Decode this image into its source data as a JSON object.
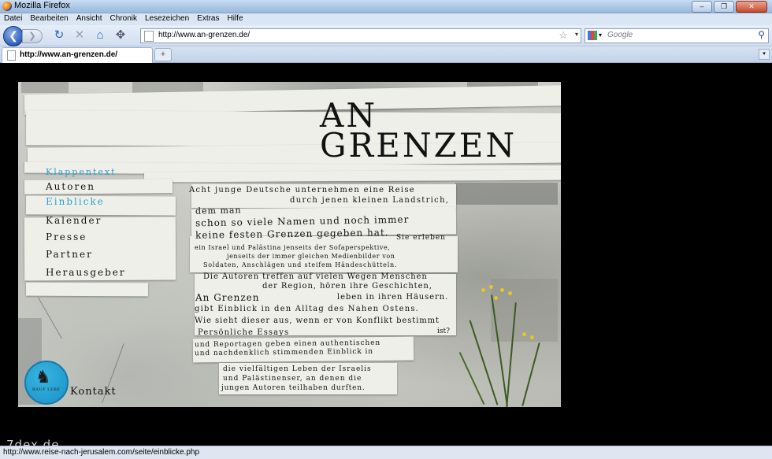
{
  "window": {
    "title": "Mozilla Firefox",
    "min_glyph": "–",
    "max_glyph": "❐",
    "close_glyph": "✕"
  },
  "menu": [
    "Datei",
    "Bearbeiten",
    "Ansicht",
    "Chronik",
    "Lesezeichen",
    "Extras",
    "Hilfe"
  ],
  "toolbar": {
    "back_glyph": "❮",
    "forward_glyph": "❯",
    "reload_glyph": "↻",
    "stop_glyph": "✕",
    "home_glyph": "⌂",
    "addon_glyph": "✥",
    "address": "http://www.an-grenzen.de/",
    "bookmark_glyph": "☆",
    "dropdown_glyph": "▾",
    "search_placeholder": "Google",
    "search_glyph": "⚲"
  },
  "tabs": [
    {
      "title": "http://www.an-grenzen.de/"
    }
  ],
  "tabbar": {
    "new_tab_glyph": "+",
    "list_glyph": "▾"
  },
  "site": {
    "logo_line1": "AN",
    "logo_line2": "GRENZEN",
    "nav": [
      {
        "label": "Klappentext",
        "active": true
      },
      {
        "label": "Autoren",
        "active": false
      },
      {
        "label": "Einblicke",
        "active": true
      },
      {
        "label": "Kalender",
        "active": false
      },
      {
        "label": "Presse",
        "active": false
      },
      {
        "label": "Partner",
        "active": false
      },
      {
        "label": "Herausgeber",
        "active": false
      }
    ],
    "blurb": [
      "Acht junge Deutsche unternehmen eine Reise",
      "durch jenen kleinen Landstrich,",
      "dem man",
      "schon so viele Namen und noch immer",
      "keine festen Grenzen gegeben hat.",
      "Sie erleben",
      "ein Israel und Palästina jenseits der Sofaperspektive,",
      "jenseits der immer gleichen Medienbilder von",
      "Soldaten, Anschlägen und steifem Händeschütteln.",
      "Die Autoren treffen auf vielen Wegen Menschen",
      "der Region, hören ihre Geschichten,",
      "An Grenzen",
      "leben in ihren Häusern.",
      "gibt Einblick in den Alltag des Nahen Ostens.",
      "Wie sieht dieser aus, wenn er von Konflikt bestimmt",
      "Persönliche Essays",
      "ist?",
      "und Reportagen geben einen authentischen",
      "und nachdenklich stimmenden Einblick in",
      "die vielfältigen Leben der Israelis",
      "und Palästinenser, an denen die",
      "jungen Autoren teilhaben durften."
    ],
    "badge_text": "RAUF LEBE",
    "contact": "Kontakt"
  },
  "watermark": "7dex.de",
  "status": "http://www.reise-nach-jerusalem.com/seite/einblicke.php"
}
